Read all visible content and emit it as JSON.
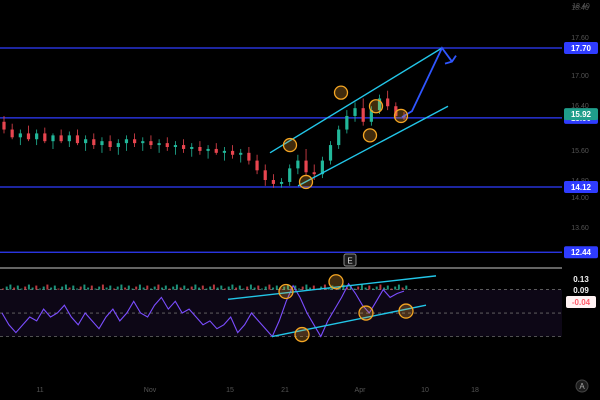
{
  "chart_data": [
    {
      "type": "candlestick",
      "title": "",
      "ylim": [
        11.6,
        18.4
      ],
      "grid": false,
      "price_axis_ticks": [
        "18.40",
        "17.60",
        "17.00",
        "16.40",
        "15.60",
        "14.80",
        "14.00",
        "13.60",
        "12.80"
      ],
      "horizontal_levels": [
        {
          "value": 17.7,
          "label": "17.70",
          "color": "#2f3cff"
        },
        {
          "value": 15.9,
          "label": "15.90",
          "color": "#2f3cff"
        },
        {
          "value": 14.12,
          "label": "14.12",
          "color": "#2f3cff"
        },
        {
          "value": 12.44,
          "label": "12.44",
          "color": "#2f3cff"
        }
      ],
      "last_price": {
        "value": 15.92,
        "label": "15.92",
        "color": "#1f9e8b"
      },
      "candles_ohlc_approx": [
        [
          15.8,
          15.95,
          15.5,
          15.6
        ],
        [
          15.6,
          15.75,
          15.35,
          15.4
        ],
        [
          15.4,
          15.6,
          15.2,
          15.5
        ],
        [
          15.5,
          15.7,
          15.3,
          15.35
        ],
        [
          15.35,
          15.6,
          15.2,
          15.5
        ],
        [
          15.5,
          15.65,
          15.25,
          15.3
        ],
        [
          15.3,
          15.5,
          15.1,
          15.45
        ],
        [
          15.45,
          15.6,
          15.25,
          15.3
        ],
        [
          15.3,
          15.55,
          15.15,
          15.45
        ],
        [
          15.45,
          15.6,
          15.2,
          15.25
        ],
        [
          15.25,
          15.45,
          15.05,
          15.35
        ],
        [
          15.35,
          15.5,
          15.1,
          15.2
        ],
        [
          15.2,
          15.4,
          15.0,
          15.3
        ],
        [
          15.3,
          15.45,
          15.05,
          15.15
        ],
        [
          15.15,
          15.35,
          14.95,
          15.25
        ],
        [
          15.25,
          15.45,
          15.05,
          15.35
        ],
        [
          15.35,
          15.5,
          15.15,
          15.25
        ],
        [
          15.25,
          15.4,
          15.05,
          15.3
        ],
        [
          15.3,
          15.45,
          15.1,
          15.2
        ],
        [
          15.2,
          15.35,
          15.0,
          15.25
        ],
        [
          15.25,
          15.4,
          15.05,
          15.15
        ],
        [
          15.15,
          15.3,
          14.95,
          15.2
        ],
        [
          15.2,
          15.35,
          15.0,
          15.1
        ],
        [
          15.1,
          15.25,
          14.9,
          15.15
        ],
        [
          15.15,
          15.3,
          14.95,
          15.05
        ],
        [
          15.05,
          15.2,
          14.85,
          15.1
        ],
        [
          15.1,
          15.25,
          14.95,
          15.0
        ],
        [
          15.0,
          15.15,
          14.8,
          15.05
        ],
        [
          15.05,
          15.2,
          14.85,
          14.95
        ],
        [
          14.95,
          15.1,
          14.75,
          15.0
        ],
        [
          15.0,
          15.15,
          14.7,
          14.8
        ],
        [
          14.8,
          14.95,
          14.45,
          14.55
        ],
        [
          14.55,
          14.7,
          14.15,
          14.3
        ],
        [
          14.3,
          14.45,
          14.1,
          14.2
        ],
        [
          14.2,
          14.35,
          14.1,
          14.25
        ],
        [
          14.25,
          14.7,
          14.15,
          14.6
        ],
        [
          14.6,
          14.95,
          14.45,
          14.8
        ],
        [
          14.8,
          15.1,
          14.4,
          14.5
        ],
        [
          14.5,
          14.7,
          14.3,
          14.45
        ],
        [
          14.45,
          14.9,
          14.35,
          14.8
        ],
        [
          14.8,
          15.3,
          14.7,
          15.2
        ],
        [
          15.2,
          15.7,
          15.1,
          15.6
        ],
        [
          15.6,
          16.1,
          15.5,
          15.95
        ],
        [
          15.95,
          16.3,
          15.8,
          16.15
        ],
        [
          16.15,
          16.4,
          15.7,
          15.8
        ],
        [
          15.8,
          16.2,
          15.7,
          16.1
        ],
        [
          16.1,
          16.5,
          16.0,
          16.4
        ],
        [
          16.4,
          16.6,
          16.1,
          16.2
        ],
        [
          16.2,
          16.3,
          15.9,
          15.95
        ],
        [
          15.95,
          16.05,
          15.85,
          15.92
        ]
      ],
      "projection_path_prices": [
        15.92,
        17.7,
        17.35
      ],
      "channel_upper_prices": [
        15.0,
        17.7
      ],
      "channel_lower_prices": [
        14.15,
        16.2
      ],
      "pivot_marker_prices": [
        15.2,
        14.25,
        16.2,
        16.55,
        15.45,
        15.95
      ]
    },
    {
      "type": "line",
      "title": "",
      "ylim": [
        -1.8,
        0.5
      ],
      "grid": false,
      "badges": [
        {
          "label": "0.13",
          "color": "#f2f2f2"
        },
        {
          "label": "0.09",
          "color": "#f2f2f2"
        },
        {
          "label": "-0.04",
          "color": "#ff5a6a"
        }
      ],
      "dashed_levels": [
        0,
        -0.6,
        -1.2
      ],
      "oscillator_values_approx": [
        -0.6,
        -0.9,
        -1.1,
        -0.9,
        -0.7,
        -0.8,
        -0.5,
        -0.7,
        -0.6,
        -0.4,
        -0.7,
        -0.9,
        -0.6,
        -0.8,
        -1.0,
        -0.7,
        -0.5,
        -0.8,
        -0.6,
        -0.3,
        -0.6,
        -0.7,
        -0.4,
        -0.2,
        -0.5,
        -0.3,
        -0.6,
        -0.5,
        -0.7,
        -0.9,
        -0.8,
        -1.0,
        -0.9,
        -0.7,
        -1.1,
        -0.9,
        -0.6,
        -0.8,
        -1.0,
        -1.2,
        -0.8,
        -0.3,
        0.1,
        -0.2,
        -0.6,
        -0.9,
        -1.2,
        -0.8,
        -0.5,
        -0.2,
        0.15,
        -0.1,
        -0.4,
        -0.6,
        -0.3,
        0.0,
        -0.2,
        -0.1,
        -0.04
      ],
      "trend_upper_values": [
        -0.25,
        0.35
      ],
      "trend_lower_values": [
        -1.2,
        -0.4
      ],
      "pivot_marker_values": [
        -0.05,
        0.2,
        -1.15,
        -0.6,
        -0.55
      ]
    }
  ],
  "pane_marker": {
    "label": "E"
  },
  "top_axis_label": "18.40",
  "bottom_axis": {
    "labels": [
      "11",
      "Nov",
      "15",
      "21",
      "Apr",
      "10",
      "18"
    ]
  },
  "corner_icon": "auto-scale-icon"
}
